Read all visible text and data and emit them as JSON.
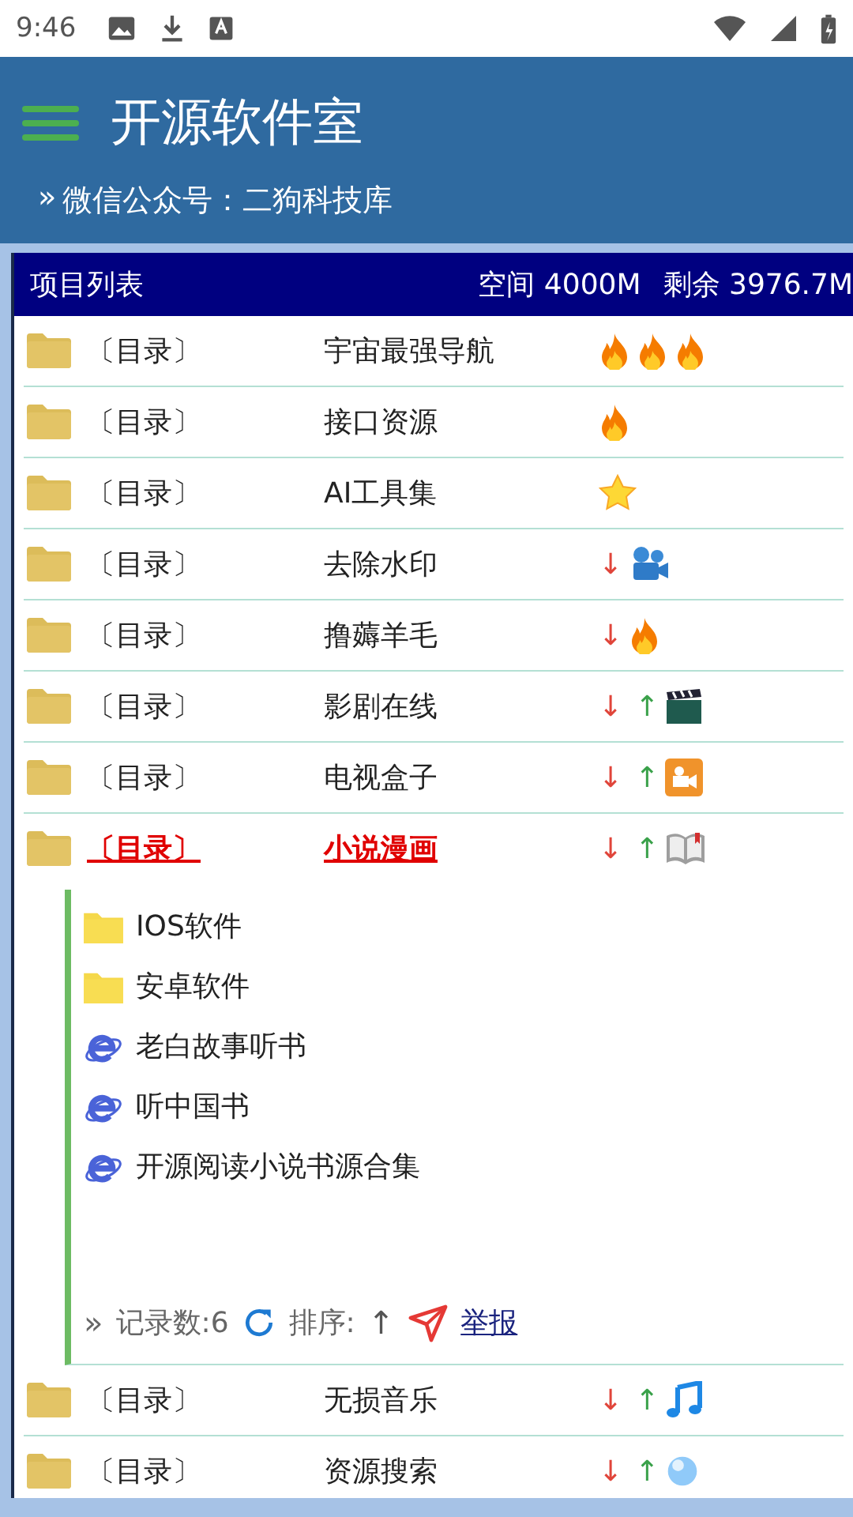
{
  "status_bar": {
    "time": "9:46"
  },
  "header": {
    "title": "开源软件室",
    "subtitle_mark": "»",
    "subtitle": "微信公众号：二狗科技库"
  },
  "panel": {
    "title": "项目列表",
    "space": "空间 4000M",
    "remaining": "剩余 3976.7M"
  },
  "rows": [
    {
      "tag": "〔目录〕",
      "name": "宇宙最强导航",
      "selected": false,
      "badges": [
        {
          "kind": "fire"
        },
        {
          "kind": "fire"
        },
        {
          "kind": "fire"
        }
      ]
    },
    {
      "tag": "〔目录〕",
      "name": "接口资源",
      "selected": false,
      "badges": [
        {
          "kind": "fire"
        }
      ]
    },
    {
      "tag": "〔目录〕",
      "name": "AI工具集",
      "selected": false,
      "badges": [
        {
          "kind": "star"
        }
      ]
    },
    {
      "tag": "〔目录〕",
      "name": "去除水印",
      "selected": false,
      "down": "↓",
      "badges": [
        {
          "kind": "movie-camera"
        }
      ]
    },
    {
      "tag": "〔目录〕",
      "name": "撸薅羊毛",
      "selected": false,
      "down": "↓",
      "badges": [
        {
          "kind": "fire"
        }
      ]
    },
    {
      "tag": "〔目录〕",
      "name": "影剧在线",
      "selected": false,
      "down": "↓",
      "up": "↑",
      "badges": [
        {
          "kind": "clapper"
        }
      ]
    },
    {
      "tag": "〔目录〕",
      "name": "电视盒子",
      "selected": false,
      "down": "↓",
      "up": "↑",
      "badges": [
        {
          "kind": "video"
        }
      ]
    },
    {
      "tag": "〔目录〕",
      "name": "小说漫画",
      "selected": true,
      "down": "↓",
      "up": "↑",
      "badges": [
        {
          "kind": "book"
        }
      ],
      "children": [
        {
          "kind": "folder",
          "name": "IOS软件"
        },
        {
          "kind": "folder",
          "name": "安卓软件"
        },
        {
          "kind": "link",
          "name": "老白故事听书"
        },
        {
          "kind": "link",
          "name": "听中国书"
        },
        {
          "kind": "link",
          "name": "开源阅读小说书源合集"
        }
      ],
      "footer": {
        "mark": "»",
        "count": "记录数:6",
        "sort": "排序:",
        "sort_arrow": "↑",
        "report": "举报"
      }
    },
    {
      "tag": "〔目录〕",
      "name": "无损音乐",
      "selected": false,
      "down": "↓",
      "up": "↑",
      "badges": [
        {
          "kind": "music"
        }
      ]
    },
    {
      "tag": "〔目录〕",
      "name": "资源搜索",
      "selected": false,
      "down": "↓",
      "up": "↑",
      "badges": [
        {
          "kind": "globe"
        }
      ]
    }
  ]
}
